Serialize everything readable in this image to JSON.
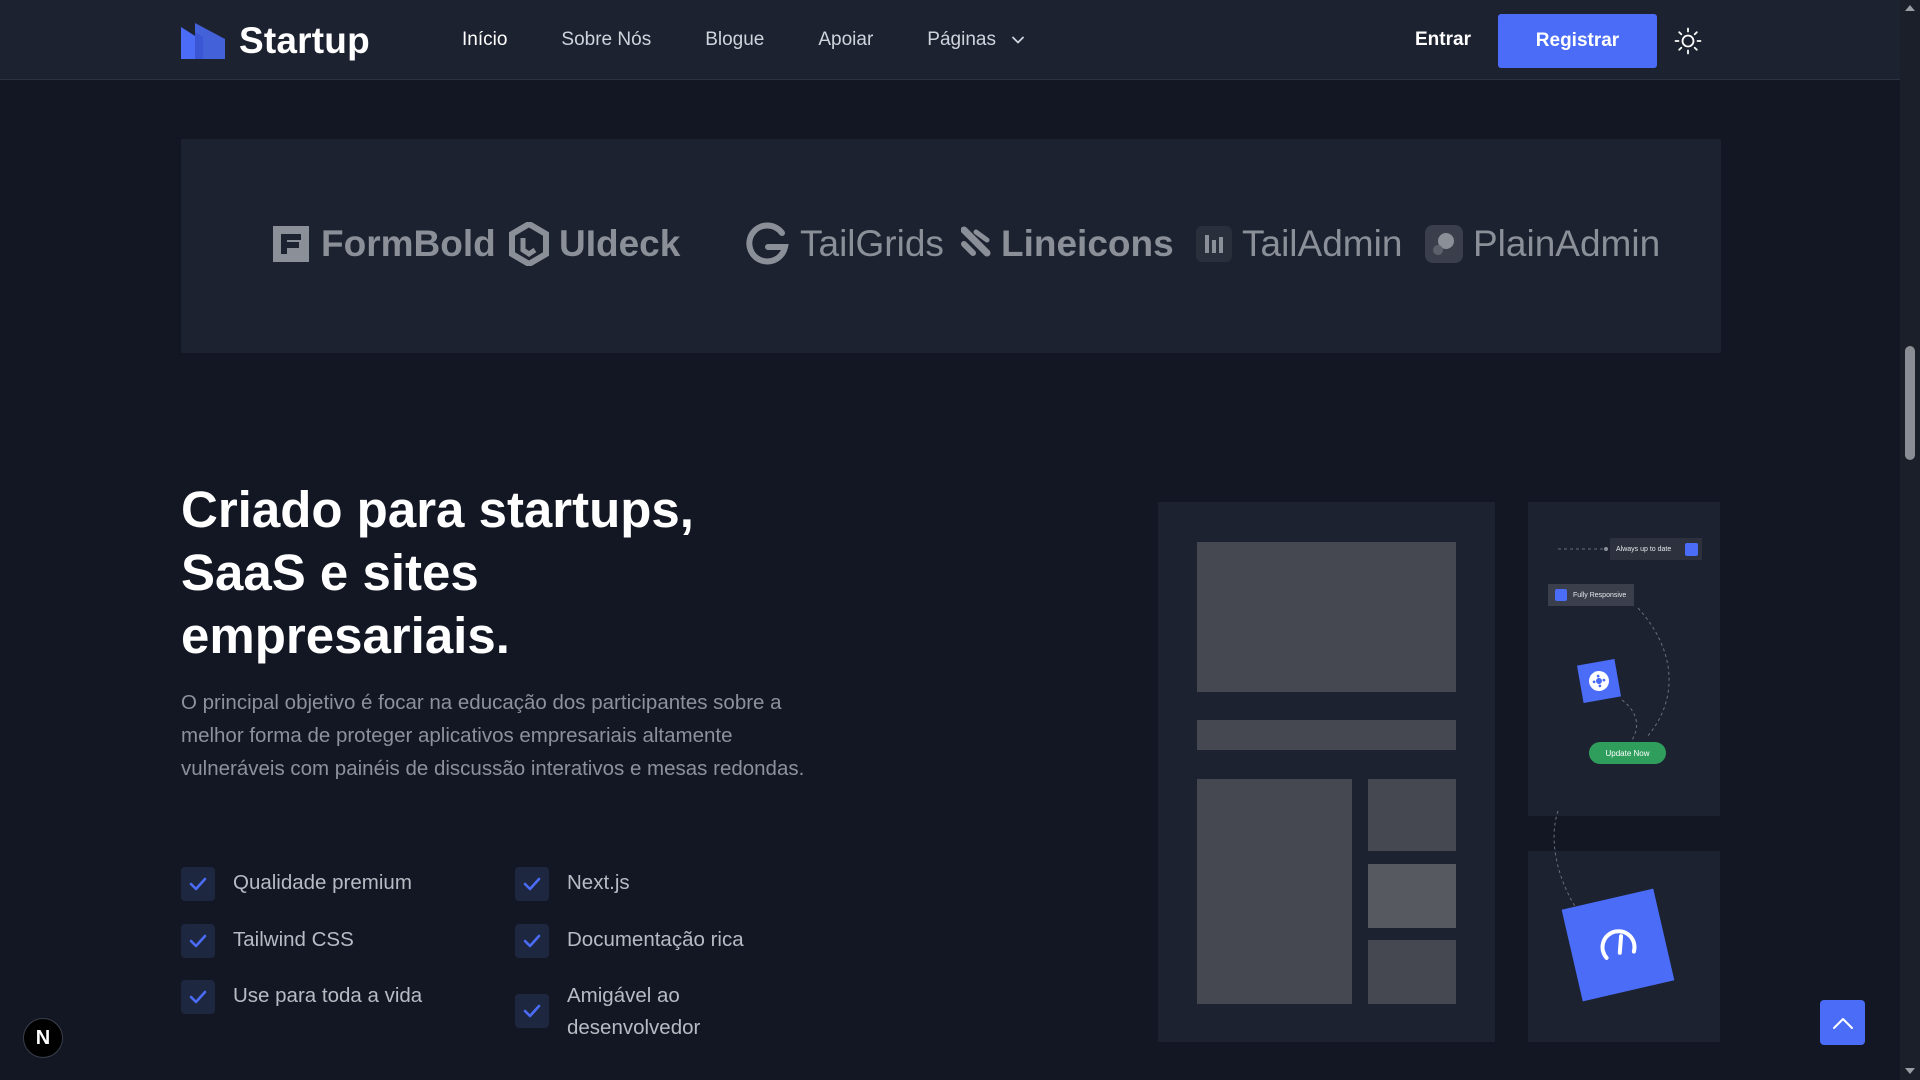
{
  "header": {
    "logo_text": "Startup",
    "nav": [
      {
        "label": "Início",
        "active": true
      },
      {
        "label": "Sobre Nós"
      },
      {
        "label": "Blogue"
      },
      {
        "label": "Apoiar"
      },
      {
        "label": "Páginas",
        "has_dropdown": true
      }
    ],
    "signin_label": "Entrar",
    "register_label": "Registrar",
    "theme_icon": "sun-icon",
    "accent_color": "#4a6cf7"
  },
  "brands": [
    "FormBold",
    "UIdeck",
    "TailGrids",
    "Lineicons",
    "TailAdmin",
    "PlainAdmin"
  ],
  "features_section": {
    "headline": "Criado para startups, SaaS e sites empresariais.",
    "description": "O principal objetivo é focar na educação dos participantes sobre a melhor forma de proteger aplicativos empresariais altamente vulneráveis com painéis de discussão interativos e mesas redondas.",
    "features": [
      "Qualidade premium",
      "Tailwind CSS",
      "Use para toda a vida",
      "Next.js",
      "Documentação rica",
      "Amigável ao desenvolvedor"
    ]
  },
  "illustration": {
    "tag_always_up_to_date": "Always up to date",
    "tag_fully_responsive": "Fully Responsive",
    "update_button": "Update Now"
  },
  "floating": {
    "next_badge": "N",
    "scroll_top_icon": "chevron-up-icon"
  }
}
